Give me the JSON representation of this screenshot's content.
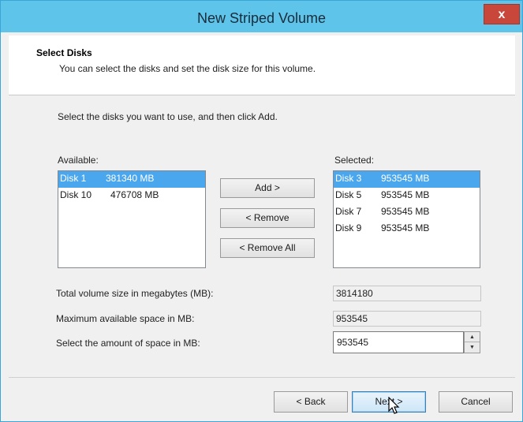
{
  "window": {
    "title": "New Striped Volume",
    "close_label": "x"
  },
  "header": {
    "title": "Select Disks",
    "subtitle": "You can select the disks and set the disk size for this volume."
  },
  "instruction": "Select the disks you want to use, and then click Add.",
  "available": {
    "label": "Available:",
    "items": [
      {
        "disk": "Disk 1",
        "size": "381340 MB",
        "selected": true
      },
      {
        "disk": "Disk 10",
        "size": "476708 MB",
        "selected": false
      }
    ]
  },
  "selected": {
    "label": "Selected:",
    "items": [
      {
        "disk": "Disk 3",
        "size": "953545 MB",
        "selected": true
      },
      {
        "disk": "Disk 5",
        "size": "953545 MB",
        "selected": false
      },
      {
        "disk": "Disk 7",
        "size": "953545 MB",
        "selected": false
      },
      {
        "disk": "Disk 9",
        "size": "953545 MB",
        "selected": false
      }
    ]
  },
  "buttons": {
    "add": "Add >",
    "remove": "< Remove",
    "remove_all": "< Remove All",
    "back": "< Back",
    "next": "Next >",
    "cancel": "Cancel"
  },
  "fields": {
    "total_label": "Total volume size in megabytes (MB):",
    "total_value": "3814180",
    "max_label": "Maximum available space in MB:",
    "max_value": "953545",
    "amount_label": "Select the amount of space in MB:",
    "amount_value": "953545"
  },
  "colors": {
    "titlebar": "#5fc4ea",
    "selection": "#4aa7ee",
    "close": "#c9473a"
  }
}
